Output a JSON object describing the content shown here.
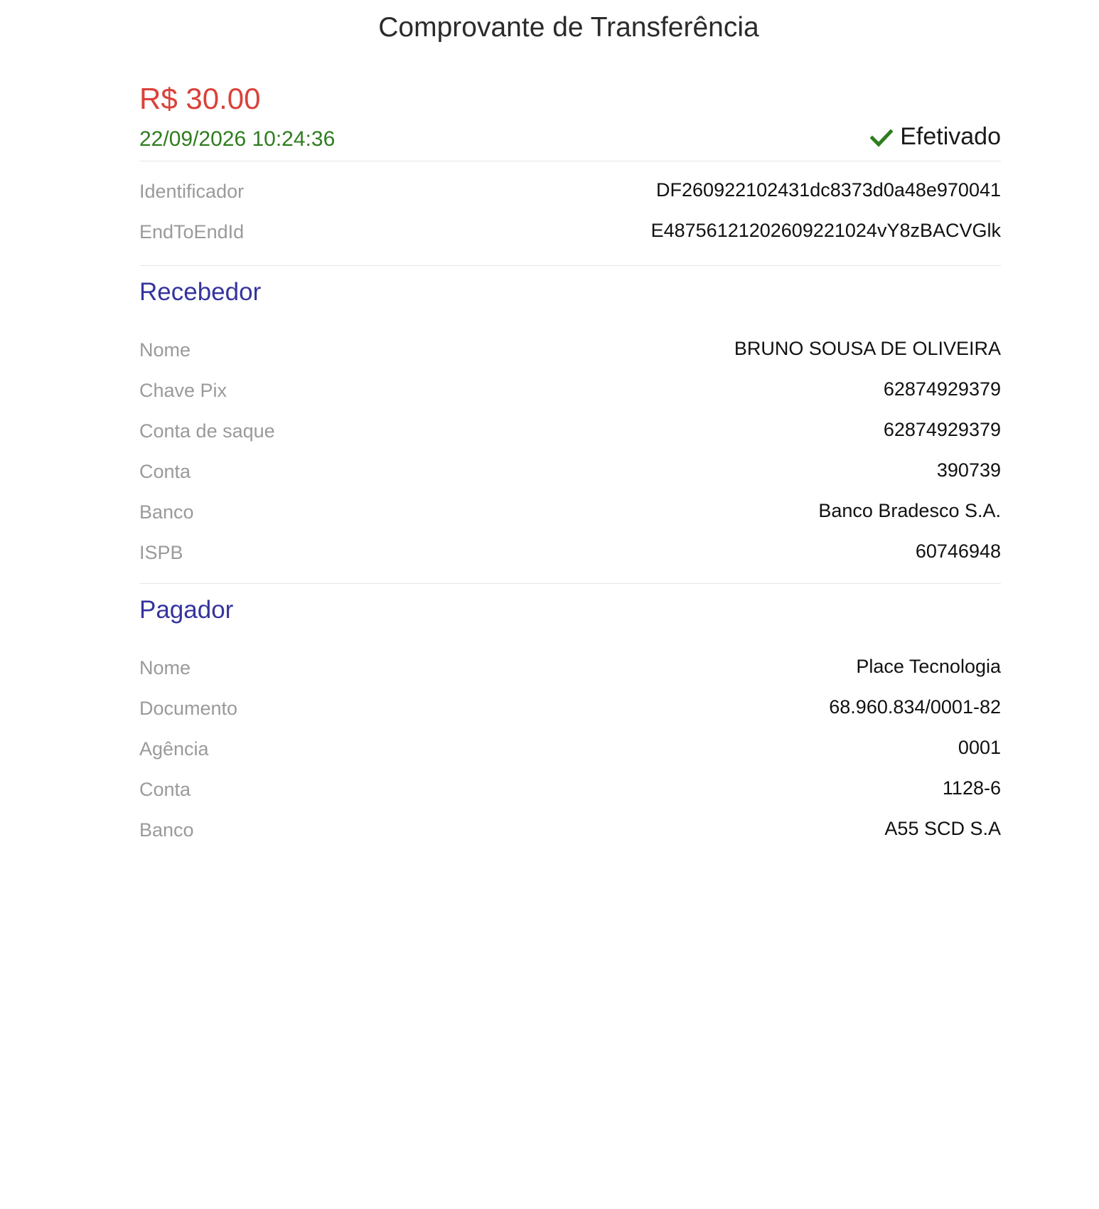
{
  "header": {
    "title": "Comprovante de Transferência"
  },
  "summary": {
    "amount": "R$ 30.00",
    "datetime": "22/09/2026 10:24:36",
    "status": "Efetivado",
    "status_icon": "check-icon",
    "amount_color": "#d9423b",
    "datetime_color": "#2f7d1f",
    "status_icon_color": "#2f7d1f"
  },
  "identifiers": {
    "identificador_label": "Identificador",
    "identificador_value": "DF260922102431dc8373d0a48e970041",
    "endtoend_label": "EndToEndId",
    "endtoend_value": "E48756121202609221024vY8zBACVGlk"
  },
  "recebedor": {
    "title": "Recebedor",
    "rows": [
      {
        "label": "Nome",
        "value": "BRUNO SOUSA DE OLIVEIRA"
      },
      {
        "label": "Chave Pix",
        "value": "62874929379"
      },
      {
        "label": "Conta de saque",
        "value": "62874929379"
      },
      {
        "label": "Conta",
        "value": "390739"
      },
      {
        "label": "Banco",
        "value": "Banco Bradesco S.A."
      },
      {
        "label": "ISPB",
        "value": "60746948"
      }
    ]
  },
  "pagador": {
    "title": "Pagador",
    "rows": [
      {
        "label": "Nome",
        "value": "Place Tecnologia"
      },
      {
        "label": "Documento",
        "value": "68.960.834/0001-82"
      },
      {
        "label": "Agência",
        "value": "0001"
      },
      {
        "label": "Conta",
        "value": "1128-6"
      },
      {
        "label": "Banco",
        "value": "A55 SCD S.A"
      }
    ]
  },
  "colors": {
    "section_title": "#35349e",
    "label": "#9a9a9a",
    "value": "#111111"
  }
}
